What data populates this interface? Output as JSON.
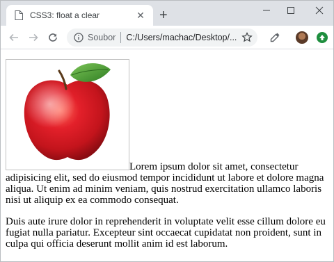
{
  "browser": {
    "tab_title": "CSS3: float a clear",
    "new_tab_symbol": "+",
    "address": {
      "site_chip": "Soubor",
      "url": "C:/Users/machac/Desktop/..."
    }
  },
  "icons": {
    "tab": "document-icon",
    "back": "arrow-left-icon",
    "forward": "arrow-right-icon",
    "reload": "reload-icon",
    "info": "info-icon",
    "bookmark": "star-icon",
    "eyedropper": "eyedropper-icon",
    "profile": "avatar",
    "extension": "green-extension-icon"
  },
  "content": {
    "image_name": "apple",
    "paragraph1": "Lorem ipsum dolor sit amet, consectetur adipisicing elit, sed do eiusmod tempor incididunt ut labore et dolore magna aliqua. Ut enim ad minim veniam, quis nostrud exercitation ullamco laboris nisi ut aliquip ex ea commodo consequat.",
    "paragraph2": "Duis aute irure dolor in reprehenderit in voluptate velit esse cillum dolore eu fugiat nulla pariatur. Excepteur sint occaecat cupidatat non proident, sunt in culpa qui officia deserunt mollit anim id est laborum."
  }
}
